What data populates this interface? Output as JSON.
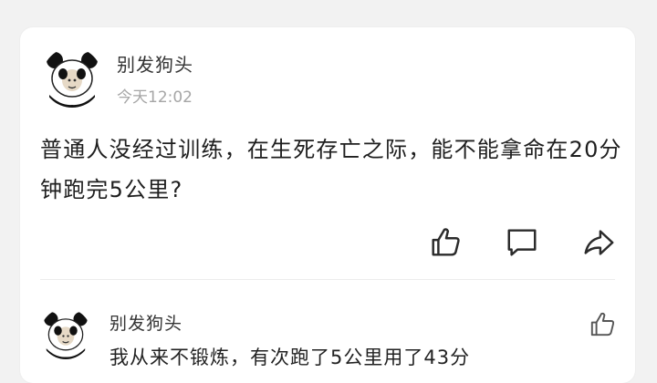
{
  "post": {
    "author": "别发狗头",
    "time": "今天12:02",
    "text": "普通人没经过训练，在生死存亡之际，能不能拿命在20分钟跑完5公里?"
  },
  "actions": {
    "like_icon": "thumbs-up-icon",
    "comment_icon": "comment-icon",
    "share_icon": "share-icon"
  },
  "comment": {
    "author": "别发狗头",
    "text": "我从来不锻炼，有次跑了5公里用了43分"
  },
  "colors": {
    "background": "#f2f2f2",
    "card": "#ffffff",
    "text": "#1e1e1e",
    "muted": "#a6a6a6",
    "icon": "#2b2b2b"
  }
}
